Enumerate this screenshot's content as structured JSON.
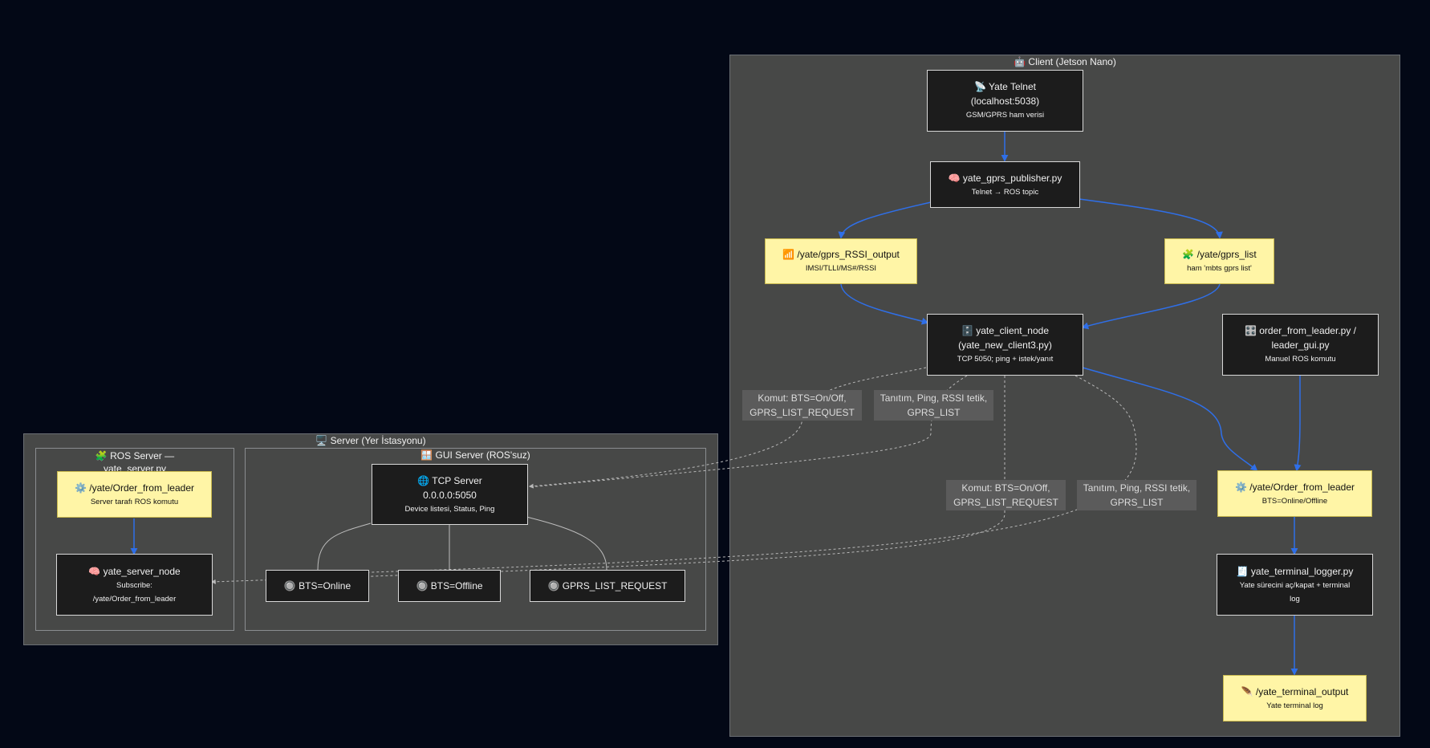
{
  "clusters": {
    "client": "🤖 Client (Jetson Nano)",
    "server": "🖥️ Server (Yer İstasyonu)",
    "ros_server": "🧩 ROS Server — yate_server.py",
    "gui_server": "🪟 GUI Server (ROS'suz)"
  },
  "nodes": {
    "yate_telnet": {
      "title1": "📡 Yate Telnet",
      "title2": "(localhost:5038)",
      "sub": "GSM/GPRS ham verisi"
    },
    "publisher": {
      "title": "🧠 yate_gprs_publisher.py",
      "sub": "Telnet → ROS topic"
    },
    "rssi": {
      "title": "📶 /yate/gprs_RSSI_output",
      "sub": "IMSI/TLLI/MS#/RSSI"
    },
    "gprs_list": {
      "title": "🧩 /yate/gprs_list",
      "sub": "ham 'mbts gprs list'"
    },
    "client_node": {
      "title1": "🗄️ yate_client_node",
      "title2": "(yate_new_client3.py)",
      "sub": "TCP 5050; ping + istek/yanıt"
    },
    "order_leader": {
      "title1": "🎛️ order_from_leader.py /",
      "title2": "leader_gui.py",
      "sub": "Manuel ROS komutu"
    },
    "order_topic_client": {
      "title": "⚙️ /yate/Order_from_leader",
      "sub": "BTS=Online/Offline"
    },
    "terminal_logger": {
      "title": "🧾 yate_terminal_logger.py",
      "sub1": "Yate sürecini aç/kapat + terminal",
      "sub2": "log"
    },
    "terminal_output": {
      "title": "🪶 /yate_terminal_output",
      "sub": "Yate terminal log"
    },
    "order_topic_server": {
      "title": "⚙️ /yate/Order_from_leader",
      "sub": "Server tarafı ROS komutu"
    },
    "server_node": {
      "title": "🧠 yate_server_node",
      "sub1": "Subscribe:",
      "sub2": "/yate/Order_from_leader"
    },
    "tcp_server": {
      "title1": "🌐 TCP Server",
      "title2": "0.0.0.0:5050",
      "sub": "Device listesi, Status, Ping"
    },
    "bts_online": {
      "title": "🔘 BTS=Online"
    },
    "bts_offline": {
      "title": "🔘 BTS=Offline"
    },
    "gprs_request": {
      "title": "🔘 GPRS_LIST_REQUEST"
    }
  },
  "edge_labels": {
    "komut1": {
      "l1": "Komut: BTS=On/Off,",
      "l2": "GPRS_LIST_REQUEST"
    },
    "tanitim1": {
      "l1": "Tanıtım, Ping, RSSI tetik,",
      "l2": "GPRS_LIST"
    },
    "komut2": {
      "l1": "Komut: BTS=On/Off,",
      "l2": "GPRS_LIST_REQUEST"
    },
    "tanitim2": {
      "l1": "Tanıtım, Ping, RSSI tetik,",
      "l2": "GPRS_LIST"
    }
  },
  "colors": {
    "background": "#030816",
    "cluster_fill": "#474847",
    "dark_node": "#1c1c1c",
    "topic_node": "#fff5a6",
    "edge_blue": "#2f6fe8",
    "edge_dashed": "#b8b8b8",
    "edge_gui": "#bdbdbd"
  }
}
